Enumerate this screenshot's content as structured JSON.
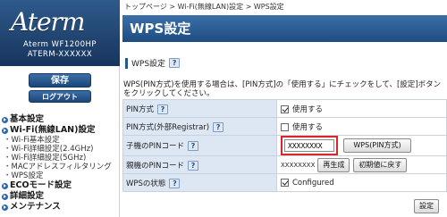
{
  "sidebar": {
    "logo": "Aterm",
    "model_line1": "Aterm WF1200HP",
    "model_line2": "ATERM-XXXXXX",
    "save_label": "保存",
    "logout_label": "ログアウト",
    "nav": [
      {
        "label": "基本設定",
        "children": []
      },
      {
        "label": "Wi-Fi(無線LAN)設定",
        "children": [
          "Wi-Fi基本設定",
          "Wi-Fi詳細設定(2.4GHz)",
          "Wi-Fi詳細設定(5GHz)",
          "MACアドレスフィルタリング",
          "WPS設定"
        ]
      },
      {
        "label": "ECOモード設定",
        "children": []
      },
      {
        "label": "詳細設定",
        "children": []
      },
      {
        "label": "メンテナンス",
        "children": []
      }
    ]
  },
  "breadcrumb": {
    "home": "トップページ",
    "sep": ">",
    "wifi": "Wi-Fi(無線LAN)設定",
    "current": "WPS設定"
  },
  "page_title": "WPS設定",
  "section": {
    "title": "WPS設定",
    "help": "?"
  },
  "description": "WPS(PIN方式)を使用する場合は、[PIN方式]の「使用する」にチェックをして、[設定]ボタンをクリックしてください。",
  "rows": {
    "pin_method": {
      "label": "PIN方式",
      "help": "?",
      "checked": true,
      "option": "使用する"
    },
    "pin_external": {
      "label": "PIN方式(外部Registrar)",
      "help": "?",
      "checked": false,
      "option": "使用する"
    },
    "child_pin": {
      "label": "子機のPINコード",
      "help": "?",
      "value": "XXXXXXXX",
      "button": "WPS(PIN方式)"
    },
    "parent_pin": {
      "label": "親機のPINコード",
      "help": "?",
      "value": "XXXXXXXX",
      "regen": "再生成",
      "reset": "初期値に戻す"
    },
    "wps_state": {
      "label": "WPSの状態",
      "help": "?",
      "checked": true,
      "option": "Configured"
    }
  },
  "apply_label": "設定",
  "colors": {
    "title_bar": "#2a5b92",
    "label_cell": "#dde7f3",
    "highlight": "#d9262a"
  }
}
